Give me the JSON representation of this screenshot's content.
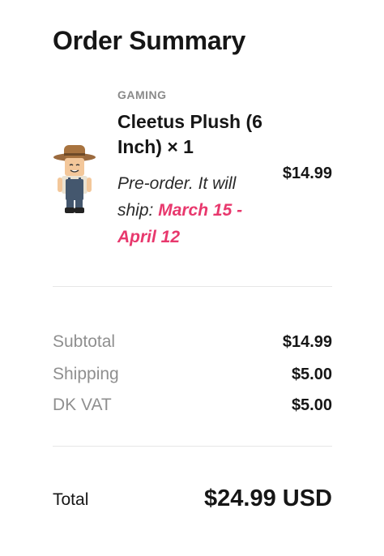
{
  "summary": {
    "title": "Order Summary"
  },
  "item": {
    "category": "GAMING",
    "name": "Cleetus Plush (6 Inch) × 1",
    "note_prefix": "Pre-order. It will ship: ",
    "note_dates": "March 15 - April 12",
    "price": "$14.99",
    "thumbnail_icon": "plush-figure-icon"
  },
  "totals": {
    "subtotal_label": "Subtotal",
    "subtotal_value": "$14.99",
    "shipping_label": "Shipping",
    "shipping_value": "$5.00",
    "vat_label": "DK VAT",
    "vat_value": "$5.00",
    "total_label": "Total",
    "total_value": "$24.99 USD"
  },
  "colors": {
    "accent": "#e8386d",
    "muted": "#8f8f8f",
    "text": "#161616"
  }
}
